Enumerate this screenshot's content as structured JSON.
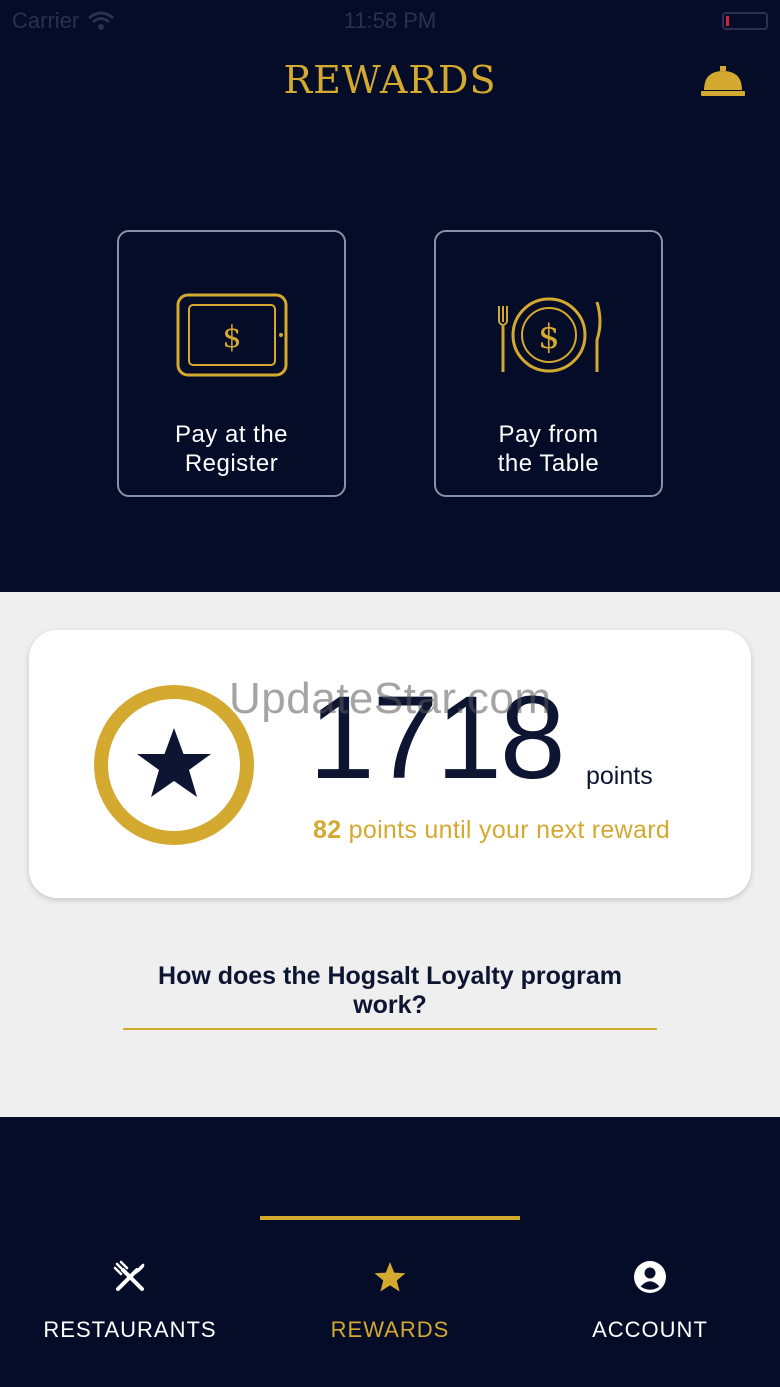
{
  "status_bar": {
    "carrier": "Carrier",
    "time": "11:58 PM"
  },
  "header": {
    "title": "REWARDS",
    "bell_icon": "service-bell-icon"
  },
  "pay_options": [
    {
      "label_line1": "Pay at the",
      "label_line2": "Register",
      "icon": "tablet-dollar-icon"
    },
    {
      "label_line1": "Pay from",
      "label_line2": "the Table",
      "icon": "plate-dollar-cutlery-icon"
    }
  ],
  "points": {
    "value": "1718",
    "unit": "points",
    "next_count": "82",
    "next_text": " points until your next reward",
    "watermark": "UpdateStar.com"
  },
  "help_link": "How does the Hogsalt Loyalty program work?",
  "tabs": [
    {
      "label": "RESTAURANTS",
      "icon": "fork-knife-icon",
      "active": false
    },
    {
      "label": "REWARDS",
      "icon": "star-icon",
      "active": true
    },
    {
      "label": "ACCOUNT",
      "icon": "account-icon",
      "active": false
    }
  ],
  "colors": {
    "navy": "#050c28",
    "gold": "#d4a930",
    "light_bg": "#efefef",
    "text_dark": "#0d1533"
  }
}
